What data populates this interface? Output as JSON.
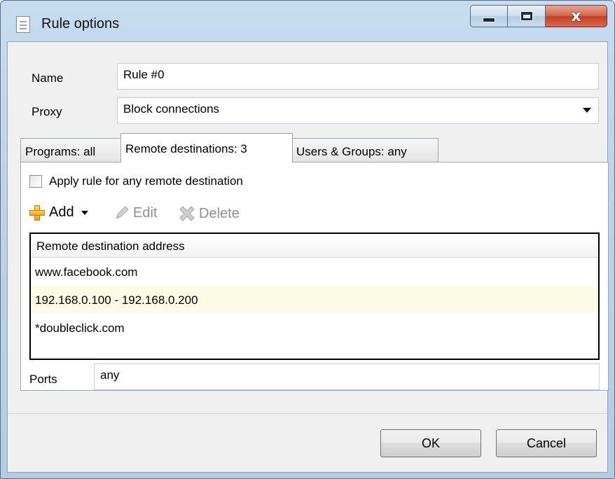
{
  "window": {
    "title": "Rule options",
    "controls": {
      "minimize": "minimize",
      "maximize": "maximize",
      "close": "x"
    }
  },
  "form": {
    "name_label": "Name",
    "name_value": "Rule #0",
    "proxy_label": "Proxy",
    "proxy_value": "Block connections"
  },
  "tabs": [
    {
      "label": "Programs: all",
      "active": false
    },
    {
      "label": "Remote destinations: 3",
      "active": true
    },
    {
      "label": "Users & Groups: any",
      "active": false
    }
  ],
  "remote_destinations": {
    "apply_any_label": "Apply rule for any remote destination",
    "apply_any_checked": false,
    "toolbar": {
      "add": "Add",
      "edit": "Edit",
      "delete": "Delete"
    },
    "column_header": "Remote destination address",
    "rows": [
      "www.facebook.com",
      "192.168.0.100 - 192.168.0.200",
      "*doubleclick.com"
    ],
    "ports_label": "Ports",
    "ports_value": "any"
  },
  "buttons": {
    "ok": "OK",
    "cancel": "Cancel"
  },
  "colors": {
    "frame": "#bcd3ea",
    "close_button": "#c9503a",
    "row_highlight": "#fcfce6",
    "add_icon": "#f5b526"
  },
  "icons": [
    "document-icon",
    "plus-icon",
    "pencil-icon",
    "delete-x-icon",
    "chevron-down-icon"
  ]
}
